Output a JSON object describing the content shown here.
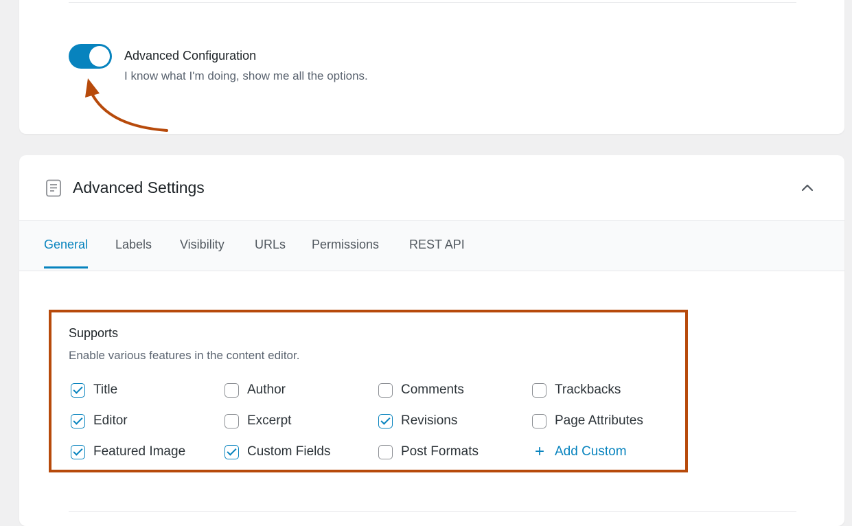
{
  "advanced_config": {
    "title": "Advanced Configuration",
    "description": "I know what I'm doing, show me all the options.",
    "enabled": true
  },
  "advanced_settings": {
    "title": "Advanced Settings",
    "tabs": [
      {
        "label": "General",
        "active": true
      },
      {
        "label": "Labels",
        "active": false
      },
      {
        "label": "Visibility",
        "active": false
      },
      {
        "label": "URLs",
        "active": false
      },
      {
        "label": "Permissions",
        "active": false
      },
      {
        "label": "REST API",
        "active": false
      }
    ]
  },
  "supports": {
    "title": "Supports",
    "description": "Enable various features in the content editor.",
    "options": [
      {
        "label": "Title",
        "checked": true
      },
      {
        "label": "Author",
        "checked": false
      },
      {
        "label": "Comments",
        "checked": false
      },
      {
        "label": "Trackbacks",
        "checked": false
      },
      {
        "label": "Editor",
        "checked": true
      },
      {
        "label": "Excerpt",
        "checked": false
      },
      {
        "label": "Revisions",
        "checked": true
      },
      {
        "label": "Page Attributes",
        "checked": false
      },
      {
        "label": "Featured Image",
        "checked": true
      },
      {
        "label": "Custom Fields",
        "checked": true
      },
      {
        "label": "Post Formats",
        "checked": false
      }
    ],
    "add_custom_label": "Add Custom"
  },
  "colors": {
    "accent": "#0783be",
    "highlight": "#b74a0b"
  }
}
